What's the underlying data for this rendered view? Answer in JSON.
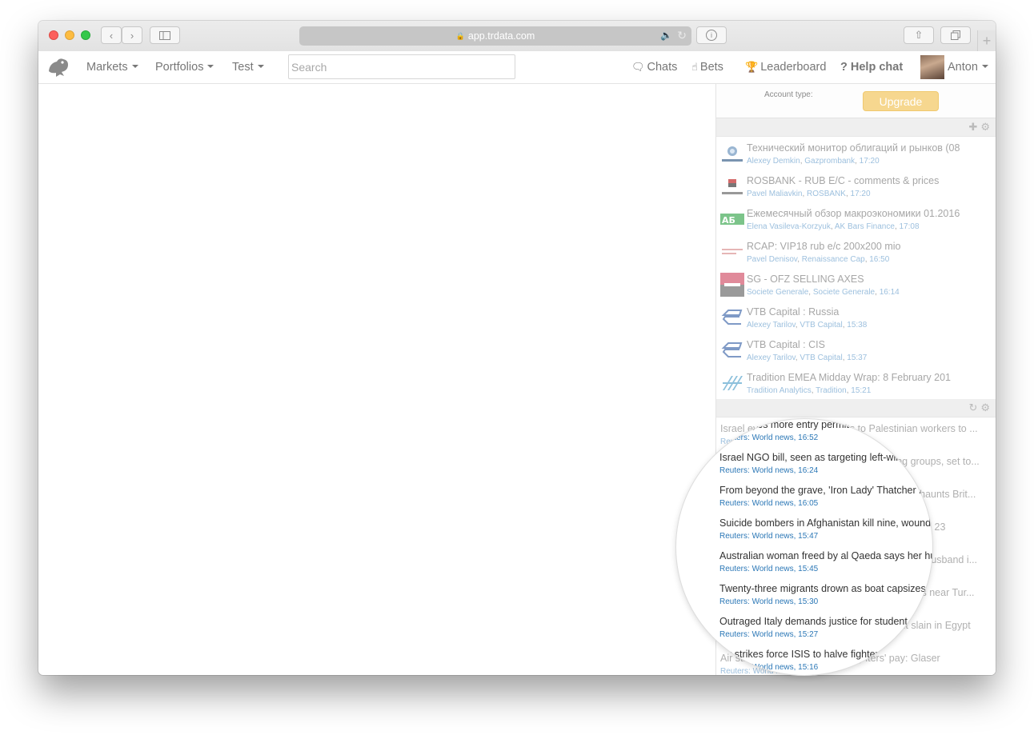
{
  "browser": {
    "url": "app.trdata.com"
  },
  "nav": {
    "menus": [
      {
        "label": "Markets"
      },
      {
        "label": "Portfolios"
      },
      {
        "label": "Test"
      }
    ],
    "search_placeholder": "Search",
    "chats": "Chats",
    "bets": "Bets",
    "leaderboard": "Leaderboard",
    "help_chat": "? Help chat",
    "user": "Anton"
  },
  "account": {
    "label": "Account type:",
    "upgrade": "Upgrade"
  },
  "mail": [
    {
      "title": "Технический монитор облигаций и рынков (08",
      "author": "Alexey Demkin",
      "org": "Gazprombank",
      "time": "17:20",
      "logo": "gazprombank-logo"
    },
    {
      "title": "ROSBANK - RUB E/C - comments & prices",
      "author": "Pavel Maliavkin",
      "org": "ROSBANK",
      "time": "17:20",
      "logo": "rosbank-logo"
    },
    {
      "title": "Ежемесячный обзор макроэкономики 01.2016",
      "author": "Elena Vasileva-Korzyuk",
      "org": "AK Bars Finance",
      "time": "17:08",
      "logo": "akbars-logo"
    },
    {
      "title": "RCAP: VIP18 rub e/c 200x200 mio",
      "author": "Pavel Denisov",
      "org": "Renaissance Cap",
      "time": "16:50",
      "logo": "renaissance-logo"
    },
    {
      "title": "SG - OFZ SELLING AXES",
      "author": "Societe Generale",
      "org": "Societe Generale",
      "time": "16:14",
      "logo": "societe-generale-logo"
    },
    {
      "title": "VTB Capital : Russia",
      "author": "Alexey Tarilov",
      "org": "VTB Capital",
      "time": "15:38",
      "logo": "vtb-logo"
    },
    {
      "title": "VTB Capital : CIS",
      "author": "Alexey Tarilov",
      "org": "VTB Capital",
      "time": "15:37",
      "logo": "vtb-logo"
    },
    {
      "title": "Tradition EMEA Midday Wrap: 8 February 201",
      "author": "Tradition Analytics",
      "org": "Tradition",
      "time": "15:21",
      "logo": "tradition-logo"
    }
  ],
  "news": [
    {
      "title": "Israel eyes more entry permits to Palestinian workers to ...",
      "meta": "Reuters: World news, 16:52"
    },
    {
      "title": "Israel NGO bill, seen as targeting left-wing groups, set to...",
      "meta": "Reuters: World news, 16:24"
    },
    {
      "title": "From beyond the grave, 'Iron Lady' Thatcher haunts Brit...",
      "meta": "Reuters: World news, 16:05"
    },
    {
      "title": "Suicide bombers in Afghanistan kill nine, wound 23",
      "meta": "Reuters: World news, 15:47"
    },
    {
      "title": "Australian woman freed by al Qaeda says her husband i...",
      "meta": "Reuters: World news, 15:45"
    },
    {
      "title": "Twenty-three migrants drown as boat capsizes near Tur...",
      "meta": "Reuters: World news, 15:30"
    },
    {
      "title": "Outraged Italy demands justice for student slain in Egypt",
      "meta": "Reuters: World news, 15:27"
    },
    {
      "title": "Air strikes force ISIS to halve fighters' pay: Glaser",
      "meta": "Reuters: World news, 15:16"
    }
  ]
}
